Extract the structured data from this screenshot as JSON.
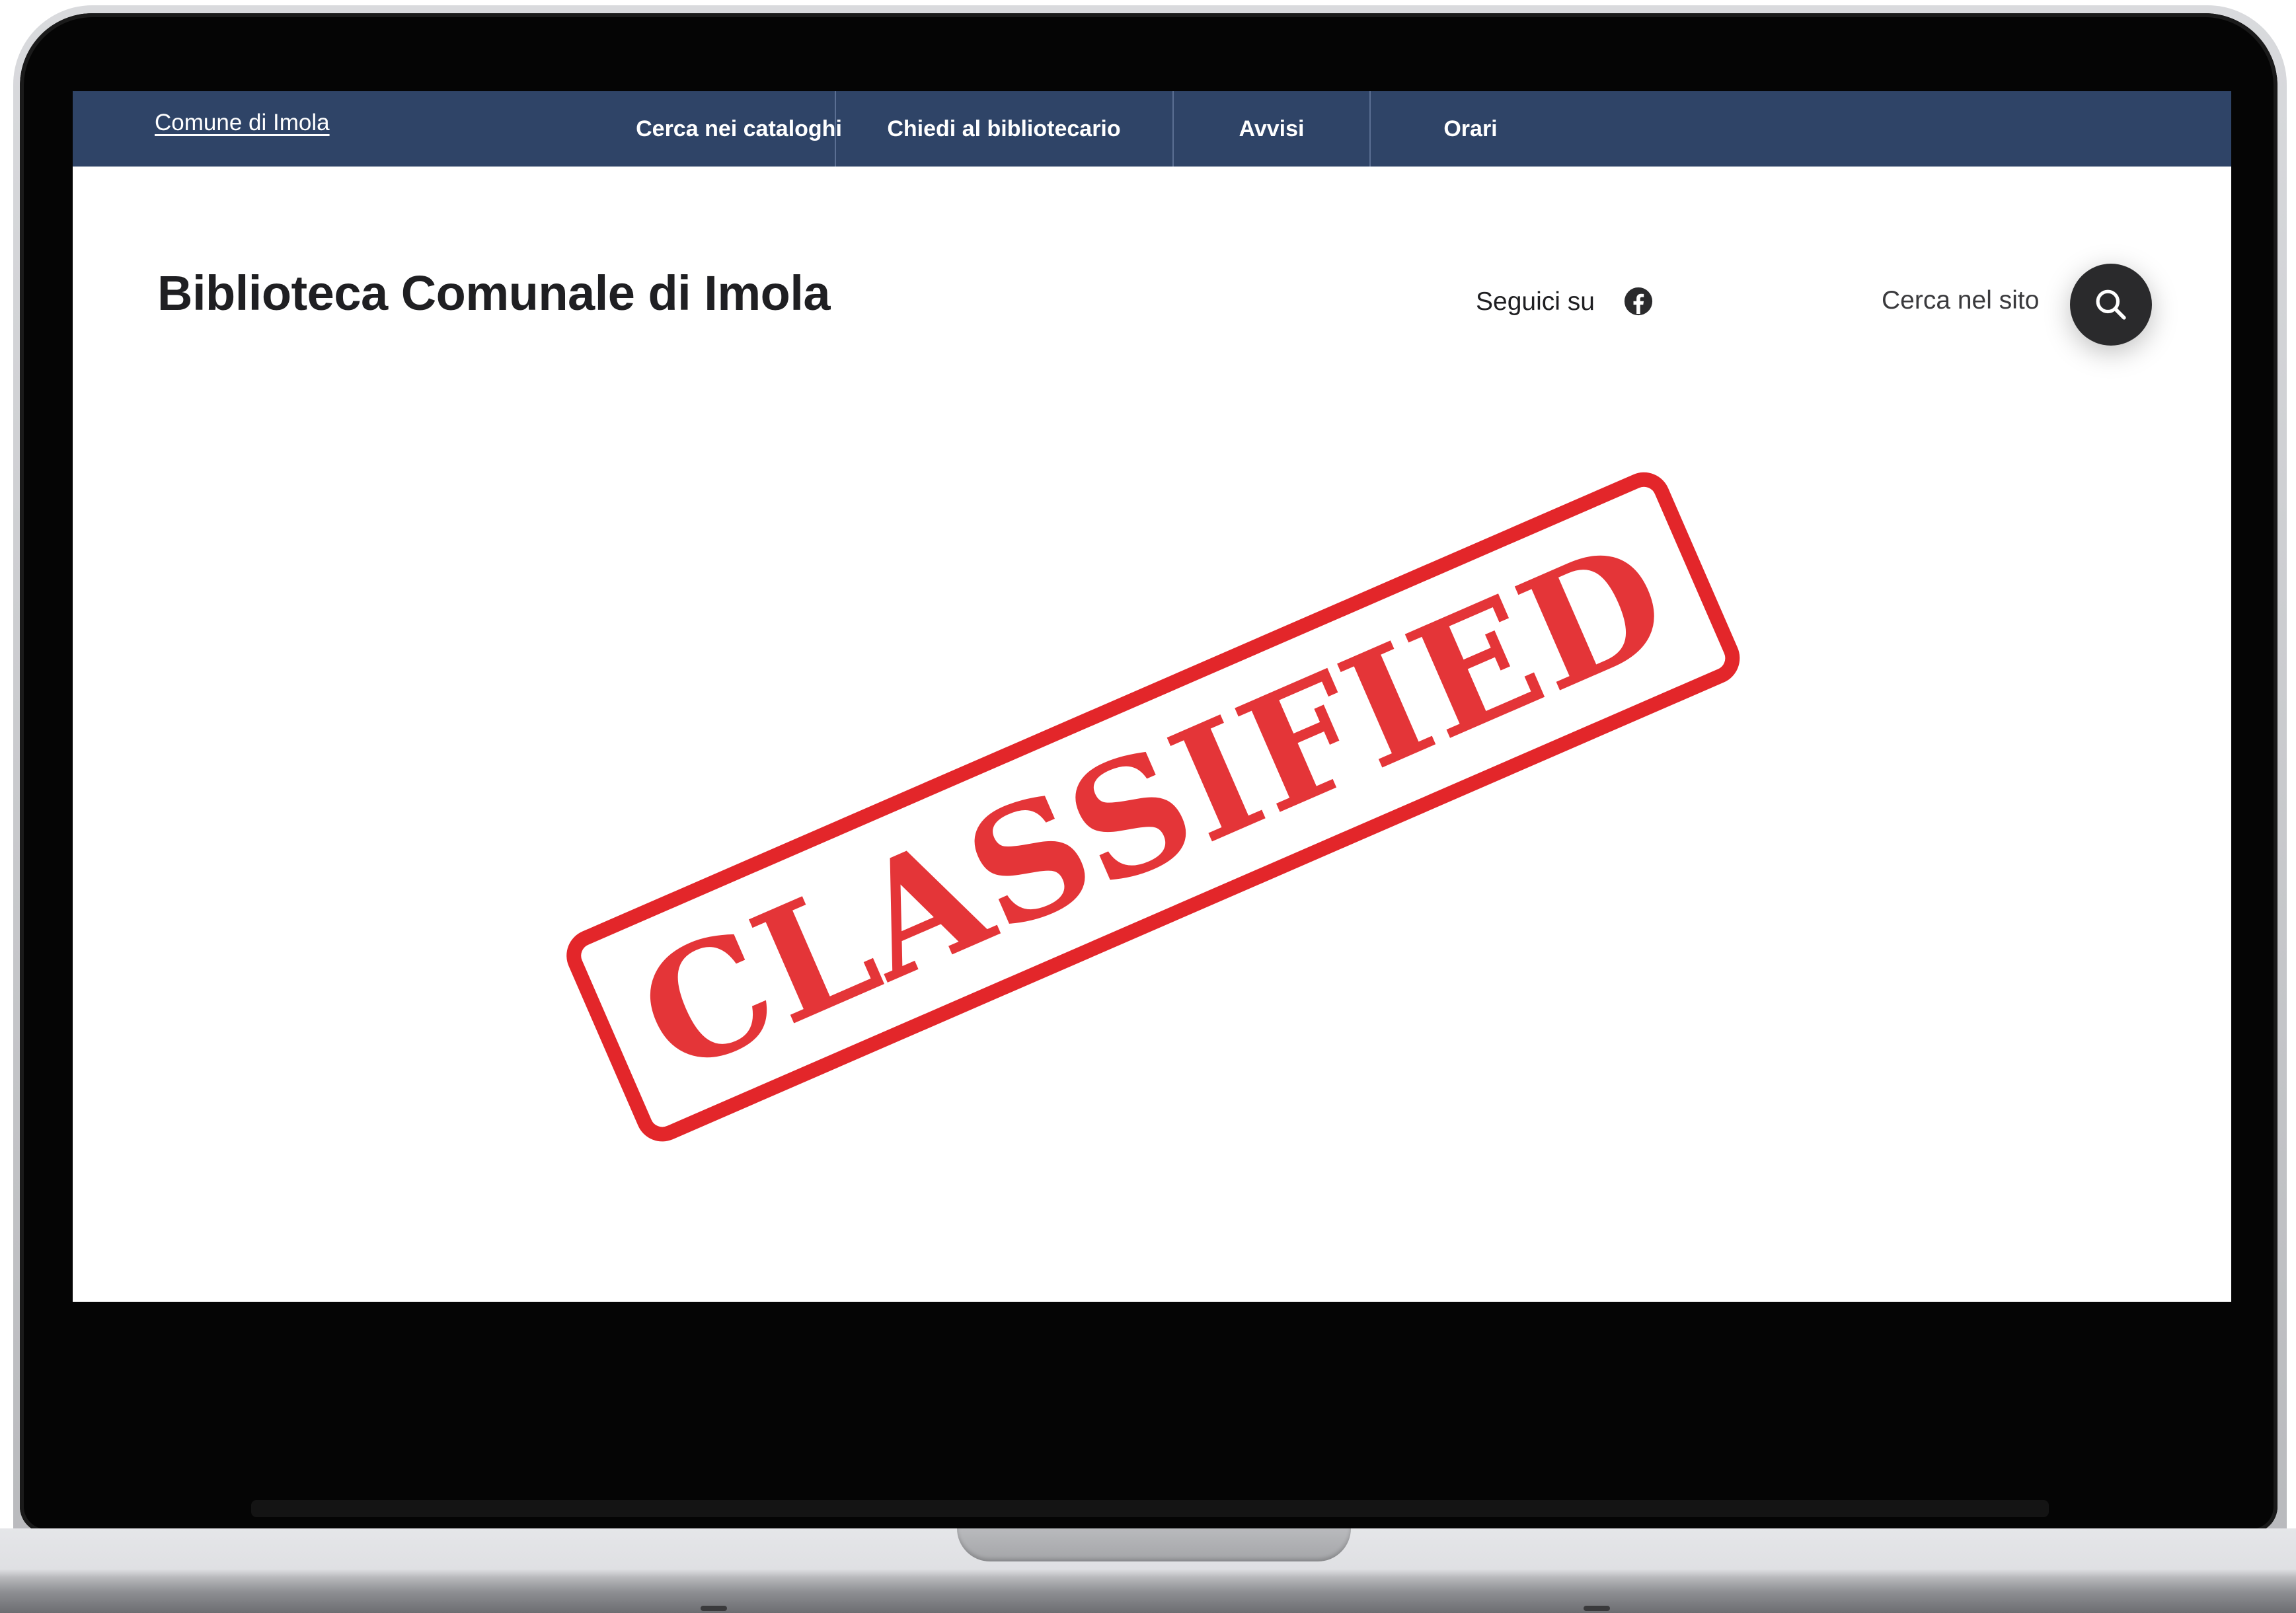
{
  "top_nav": {
    "comune_link": "Comune di Imola",
    "items": [
      {
        "label": "Cerca nei cataloghi"
      },
      {
        "label": "Chiedi al bibliotecario"
      },
      {
        "label": "Avvisi"
      },
      {
        "label": "Orari"
      }
    ]
  },
  "header": {
    "site_title": "Biblioteca Comunale di Imola",
    "social_label": "Seguici su",
    "social_icons": [
      "facebook-icon"
    ],
    "search_label": "Cerca nel sito",
    "search_icon": "search-icon"
  },
  "hero": {
    "stamp_text": "CLASSIFIED"
  },
  "colors": {
    "nav_background": "#2f4467",
    "stamp_red": "#e3262a",
    "search_button": "#2a2a2c",
    "title_text": "#1f1f22"
  }
}
